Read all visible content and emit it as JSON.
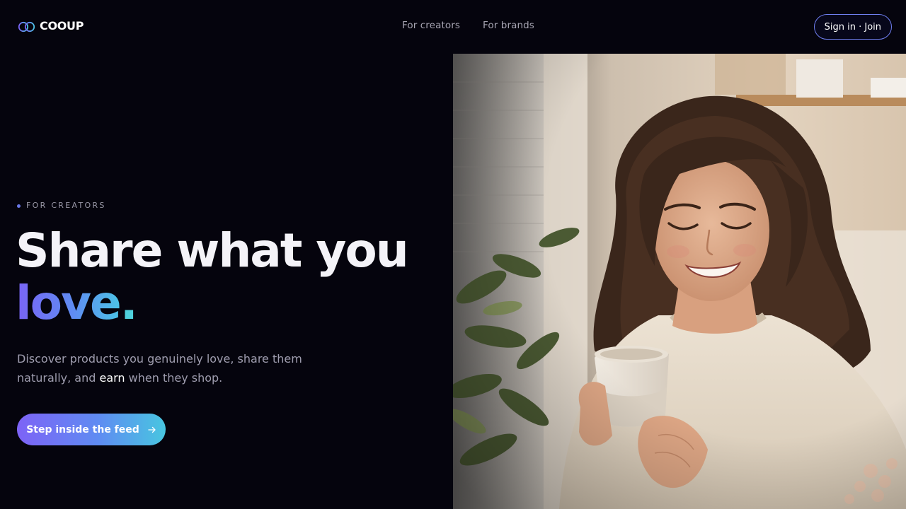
{
  "header": {
    "brand": "COOUP",
    "nav": [
      {
        "label": "For creators"
      },
      {
        "label": "For brands"
      }
    ],
    "signin_label": "Sign in · Join"
  },
  "hero": {
    "eyebrow": "FOR CREATORS",
    "headline_line1": "Share what you",
    "headline_word": "love",
    "headline_period": ".",
    "sub_part1": "Discover products you genuinely love, share them naturally, and ",
    "sub_emphasis": "earn",
    "sub_part2": " when they shop.",
    "cta_label": "Step inside the feed",
    "cta_icon": "arrow-right-icon",
    "image_alt": "Smiling woman in a cream sweater holding a ceramic cup"
  },
  "colors": {
    "background": "#05040d",
    "accent_purple": "#7a63f5",
    "accent_blue": "#5f8cf2",
    "accent_cyan": "#4cc3e6",
    "muted_text": "#9f9daf"
  }
}
